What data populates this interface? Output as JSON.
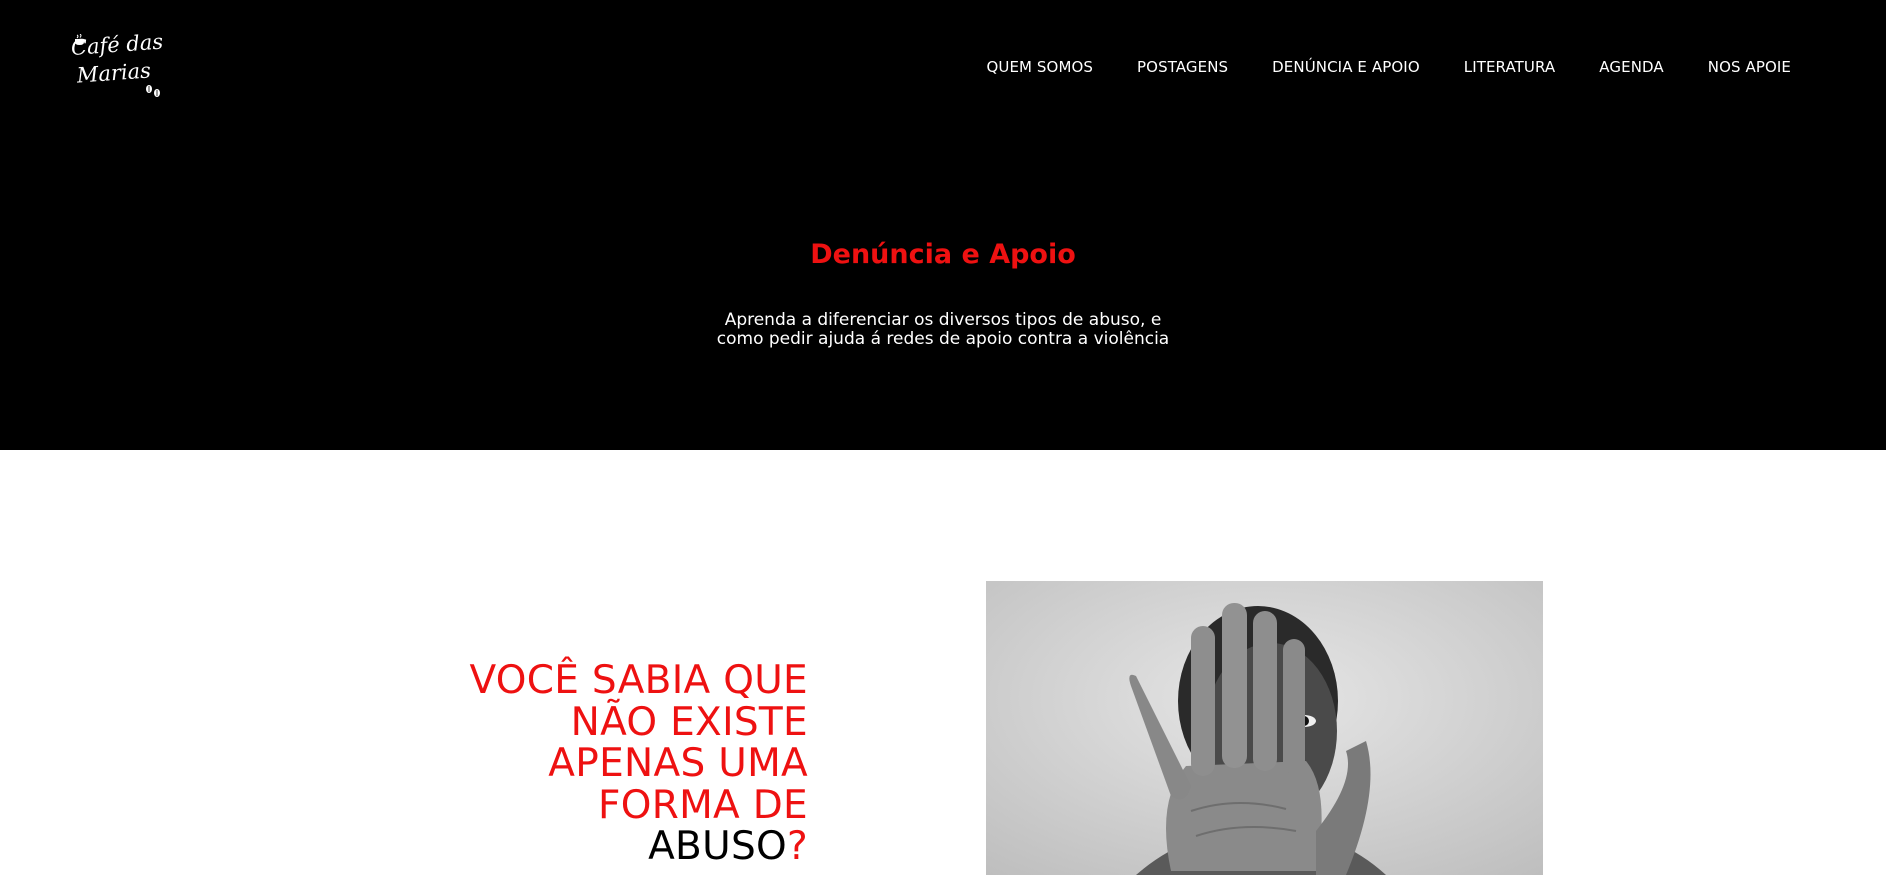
{
  "logo": {
    "line1": "Café das",
    "line2": "Marias",
    "icons": [
      "coffee-cup-icon",
      "coffee-beans-icon"
    ]
  },
  "nav": {
    "items": [
      {
        "label": "QUEM SOMOS"
      },
      {
        "label": "POSTAGENS"
      },
      {
        "label": "DENÚNCIA E APOIO"
      },
      {
        "label": "LITERATURA"
      },
      {
        "label": "AGENDA"
      },
      {
        "label": "NOS APOIE"
      }
    ]
  },
  "hero": {
    "title": "Denúncia e Apoio",
    "subtitle_line1": "Aprenda a diferenciar os diversos tipos de abuso, e",
    "subtitle_line2": "como pedir ajuda á redes de apoio contra a violência"
  },
  "section": {
    "line1": "VOCÊ SABIA QUE",
    "line2": "NÃO EXISTE",
    "line3": "APENAS UMA",
    "line4": "FORMA DE",
    "highlight": "ABUSO",
    "mark": "?"
  },
  "colors": {
    "accent": "#ee1111",
    "hero_bg": "#000000",
    "text_light": "#ffffff",
    "text_dark": "#000000"
  }
}
